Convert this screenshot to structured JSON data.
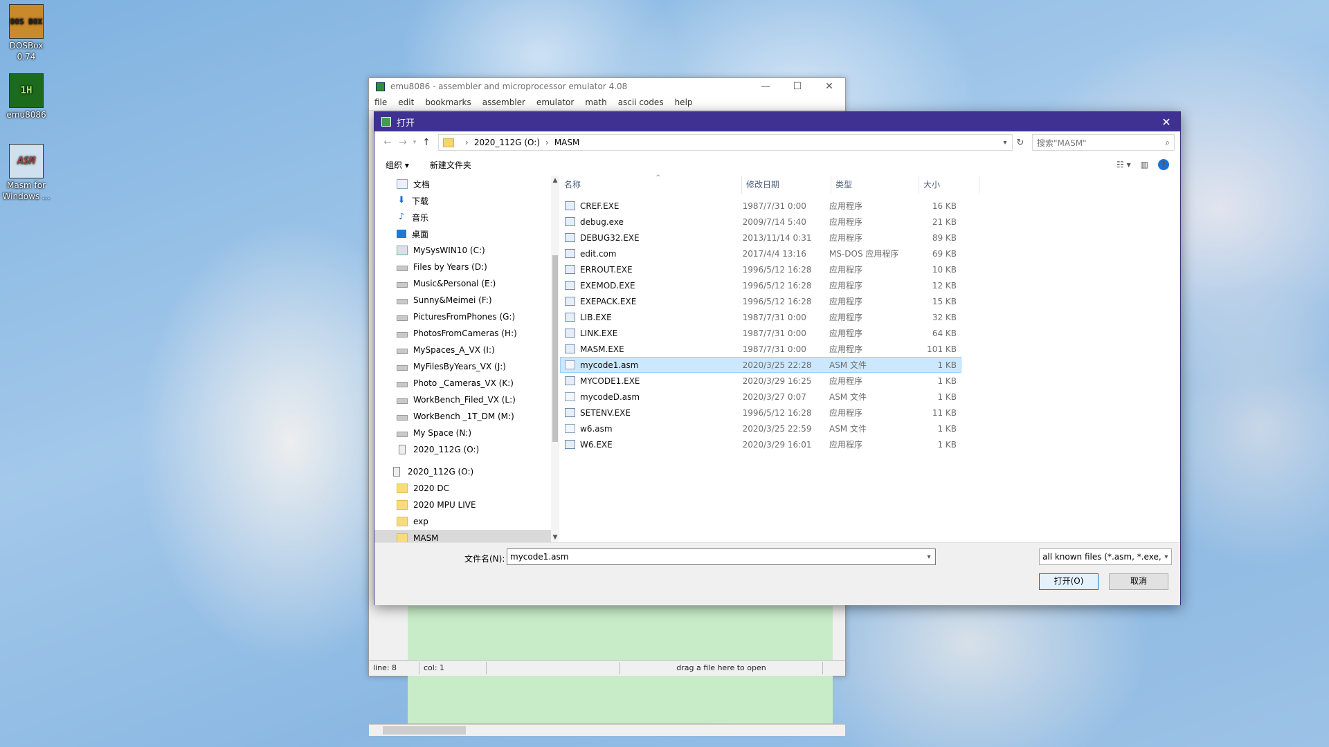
{
  "desktop": {
    "icons": [
      {
        "label1": "DOSBox",
        "label2": "0.74",
        "glyph": "DOS BOX"
      },
      {
        "label1": "emu8086",
        "label2": "",
        "glyph": "1H"
      },
      {
        "label1": "Masm for",
        "label2": "Windows ...",
        "glyph": "ASM"
      }
    ]
  },
  "emu": {
    "title": "emu8086 - assembler and microprocessor emulator 4.08",
    "menu": [
      "file",
      "edit",
      "bookmarks",
      "assembler",
      "emulator",
      "math",
      "ascii codes",
      "help"
    ],
    "status": {
      "line": "line: 8",
      "col": "col: 1",
      "hint": "drag a file here to open"
    },
    "win_minimize": "—",
    "win_maximize": "☐",
    "win_close": "✕"
  },
  "dialog": {
    "title": "打开",
    "close": "✕",
    "breadcrumb": [
      "2020_112G (O:)",
      "MASM"
    ],
    "search_placeholder": "搜索\"MASM\"",
    "toolbar": {
      "organize": "组织 ▾",
      "new_folder": "新建文件夹"
    },
    "columns": {
      "name": "名称",
      "date": "修改日期",
      "type": "类型",
      "size": "大小"
    },
    "nav": [
      {
        "label": "文档",
        "icon": "doc",
        "root": false
      },
      {
        "label": "下载",
        "icon": "down",
        "root": false
      },
      {
        "label": "音乐",
        "icon": "music",
        "root": false
      },
      {
        "label": "桌面",
        "icon": "desk",
        "root": false
      },
      {
        "label": "MySysWIN10 (C:)",
        "icon": "pc",
        "root": false
      },
      {
        "label": "Files by Years (D:)",
        "icon": "drive",
        "root": false
      },
      {
        "label": "Music&Personal (E:)",
        "icon": "drive",
        "root": false
      },
      {
        "label": "Sunny&Meimei (F:)",
        "icon": "drive",
        "root": false
      },
      {
        "label": "PicturesFromPhones (G:)",
        "icon": "drive",
        "root": false
      },
      {
        "label": "PhotosFromCameras (H:)",
        "icon": "drive",
        "root": false
      },
      {
        "label": "MySpaces_A_VX (I:)",
        "icon": "drive",
        "root": false
      },
      {
        "label": "MyFilesByYears_VX (J:)",
        "icon": "drive",
        "root": false
      },
      {
        "label": "Photo _Cameras_VX (K:)",
        "icon": "drive",
        "root": false
      },
      {
        "label": "WorkBench_Filed_VX (L:)",
        "icon": "drive",
        "root": false
      },
      {
        "label": "WorkBench _1T_DM (M:)",
        "icon": "drive",
        "root": false
      },
      {
        "label": "My Space (N:)",
        "icon": "drive",
        "root": false
      },
      {
        "label": "2020_112G (O:)",
        "icon": "usb",
        "root": false
      },
      {
        "label": "",
        "icon": "",
        "root": false,
        "spacer": true
      },
      {
        "label": "2020_112G (O:)",
        "icon": "usb",
        "root": true
      },
      {
        "label": "2020 DC",
        "icon": "folder",
        "root": false
      },
      {
        "label": "2020 MPU LIVE",
        "icon": "folder",
        "root": false
      },
      {
        "label": "exp",
        "icon": "folder",
        "root": false
      },
      {
        "label": "MASM",
        "icon": "folder",
        "root": false,
        "selected": true
      }
    ],
    "files": [
      {
        "name": "CREF.EXE",
        "date": "1987/7/31 0:00",
        "type": "应用程序",
        "size": "16 KB",
        "kind": "exe"
      },
      {
        "name": "debug.exe",
        "date": "2009/7/14 5:40",
        "type": "应用程序",
        "size": "21 KB",
        "kind": "exe"
      },
      {
        "name": "DEBUG32.EXE",
        "date": "2013/11/14 0:31",
        "type": "应用程序",
        "size": "89 KB",
        "kind": "exe"
      },
      {
        "name": "edit.com",
        "date": "2017/4/4 13:16",
        "type": "MS-DOS 应用程序",
        "size": "69 KB",
        "kind": "exe"
      },
      {
        "name": "ERROUT.EXE",
        "date": "1996/5/12 16:28",
        "type": "应用程序",
        "size": "10 KB",
        "kind": "exe"
      },
      {
        "name": "EXEMOD.EXE",
        "date": "1996/5/12 16:28",
        "type": "应用程序",
        "size": "12 KB",
        "kind": "exe"
      },
      {
        "name": "EXEPACK.EXE",
        "date": "1996/5/12 16:28",
        "type": "应用程序",
        "size": "15 KB",
        "kind": "exe"
      },
      {
        "name": "LIB.EXE",
        "date": "1987/7/31 0:00",
        "type": "应用程序",
        "size": "32 KB",
        "kind": "exe"
      },
      {
        "name": "LINK.EXE",
        "date": "1987/7/31 0:00",
        "type": "应用程序",
        "size": "64 KB",
        "kind": "exe"
      },
      {
        "name": "MASM.EXE",
        "date": "1987/7/31 0:00",
        "type": "应用程序",
        "size": "101 KB",
        "kind": "exe"
      },
      {
        "name": "mycode1.asm",
        "date": "2020/3/25 22:28",
        "type": "ASM 文件",
        "size": "1 KB",
        "kind": "asm",
        "selected": true
      },
      {
        "name": "MYCODE1.EXE",
        "date": "2020/3/29 16:25",
        "type": "应用程序",
        "size": "1 KB",
        "kind": "exe"
      },
      {
        "name": "mycodeD.asm",
        "date": "2020/3/27 0:07",
        "type": "ASM 文件",
        "size": "1 KB",
        "kind": "asm"
      },
      {
        "name": "SETENV.EXE",
        "date": "1996/5/12 16:28",
        "type": "应用程序",
        "size": "11 KB",
        "kind": "exe"
      },
      {
        "name": "w6.asm",
        "date": "2020/3/25 22:59",
        "type": "ASM 文件",
        "size": "1 KB",
        "kind": "asm"
      },
      {
        "name": "W6.EXE",
        "date": "2020/3/29 16:01",
        "type": "应用程序",
        "size": "1 KB",
        "kind": "exe"
      }
    ],
    "filename_label": "文件名(N):",
    "filename_value": "mycode1.asm",
    "filter_value": "all known files (*.asm, *.exe,",
    "open_button": "打开(O)",
    "cancel_button": "取消"
  }
}
